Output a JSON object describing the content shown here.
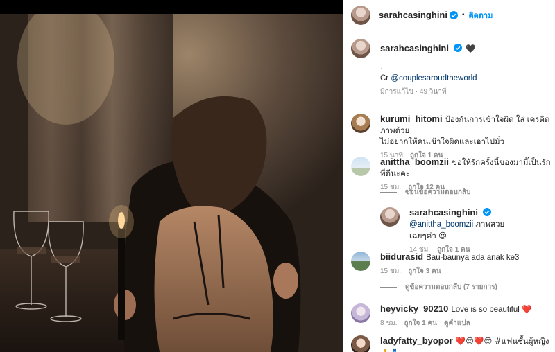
{
  "post": {
    "author": "sarahcasinghini",
    "follow_label": "ติดตาม",
    "dot": "•"
  },
  "caption": {
    "author": "sarahcasinghini",
    "emoji": "🖤",
    "line1": ".",
    "line2_prefix": "Cr ",
    "line2_link": "@couplesaroudtheworld",
    "meta": "มีการแก้ไข · 49 วินาที"
  },
  "comments": [
    {
      "user": "kurumi_hitomi",
      "text": "ป้องกันการเข้าใจผิด ใส่ เครดิตภาพด้วย",
      "text2": "ไม่อยากให้คนเข้าใจผิดและเอาไปมั่ว",
      "time": "15 นาที",
      "likes": "ถูกใจ 1 คน"
    },
    {
      "user": "anittha_boomzii",
      "text": "ขอให้รักครั้งนี้ของมามี๊เป็นรักที่ดีนะคะ",
      "time": "15 ชม.",
      "likes": "ถูกใจ 12 คน",
      "replies_toggle": "ซ่อนข้อความตอบกลับ",
      "reply": {
        "user": "sarahcasinghini",
        "mention": "@anittha_boomzii",
        "text": " ภาพสวย",
        "text2": "เฉยๆค่า",
        "emoji": "😍",
        "time": "14 ชม.",
        "likes": "ถูกใจ 1 คน"
      }
    },
    {
      "user": "biidurasid",
      "text": "Bau-baunya ada anak ke3",
      "time": "15 ชม.",
      "likes": "ถูกใจ 3 คน",
      "replies_toggle": "ดูข้อความตอบกลับ (7 รายการ)"
    },
    {
      "user": "heyvicky_90210",
      "text": "Love is so beautiful",
      "emoji": "❤️",
      "time": "8 ชม.",
      "likes": "ถูกใจ 1 คน",
      "translate": "ดูคำแปล"
    },
    {
      "user": "ladyfatty_byopor",
      "text": "❤️😍❤️😍 #แฟนชั้นผู้หญิง🙏👗"
    }
  ],
  "colors": {
    "accent": "#0095f6",
    "link": "#00376b",
    "muted": "#8e8e8e",
    "heart": "#ed4956"
  }
}
